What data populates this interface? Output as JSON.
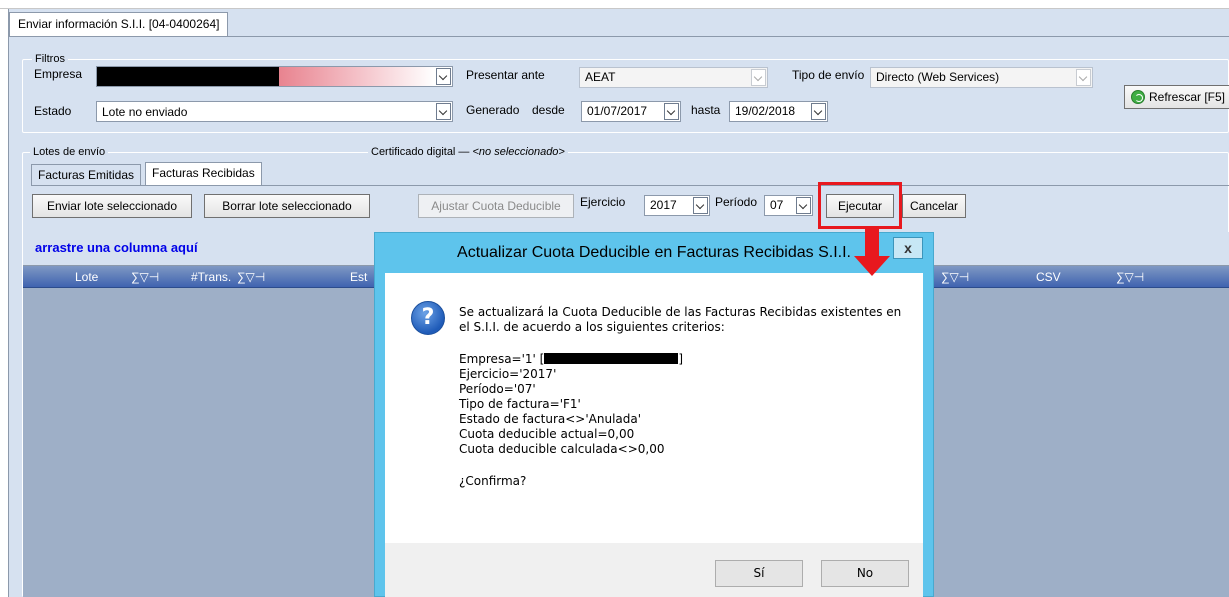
{
  "window": {
    "doc_tab": "Enviar información S.I.I. [04-0400264]"
  },
  "filters": {
    "legend": "Filtros",
    "empresa_label": "Empresa",
    "estado_label": "Estado",
    "estado_value": "Lote no enviado",
    "presentar_label": "Presentar ante",
    "presentar_value": "AEAT",
    "generado_label": "Generado",
    "desde_label": "desde",
    "desde_value": "01/07/2017",
    "hasta_label": "hasta",
    "hasta_value": "19/02/2018",
    "tipo_envio_label": "Tipo de envío",
    "tipo_envio_value": "Directo (Web Services)",
    "refresh_button": "Refrescar [F5]"
  },
  "lotes": {
    "legend": "Lotes de envío",
    "cert_legend": "Certificado digital",
    "cert_value": "<no seleccionado>",
    "tabs": [
      "Facturas Emitidas",
      "Facturas Recibidas"
    ],
    "active_tab": "Facturas Recibidas",
    "toolbar": {
      "enviar": "Enviar lote seleccionado",
      "borrar": "Borrar lote seleccionado",
      "ajustar": "Ajustar Cuota Deducible",
      "ejercicio_label": "Ejercicio",
      "ejercicio_value": "2017",
      "periodo_label": "Período",
      "periodo_value": "07",
      "ejecutar": "Ejecutar",
      "cancelar": "Cancelar"
    }
  },
  "grid": {
    "drag_hint": "arrastre una columna aquí",
    "columns": [
      "Lote",
      "#Trans.",
      "Est",
      "CSV"
    ],
    "column_tools": "∑▽⊣"
  },
  "dialog": {
    "title": "Actualizar Cuota Deducible en Facturas Recibidas S.I.I.",
    "close": "x",
    "message_line1": "Se actualizará la Cuota Deducible de las Facturas Recibidas existentes en",
    "message_line2": "el S.I.I. de acuerdo a los siguientes criterios:",
    "criteria_empresa_prefix": "Empresa='1' [",
    "criteria_empresa_suffix": "]",
    "criteria": [
      "Ejercicio='2017'",
      "Período='07'",
      "Tipo de factura='F1'",
      "Estado de factura<>'Anulada'",
      "Cuota deducible actual=0,00",
      "Cuota deducible calculada<>0,00"
    ],
    "confirm": "¿Confirma?",
    "yes": "Sí",
    "no": "No"
  },
  "colors": {
    "window_bg": "#d6e1f0",
    "grid_header": "#3f63b0",
    "dialog_frame": "#5ec4ec",
    "highlight": "#e8181e",
    "empresa_fill": "#e8838f"
  }
}
